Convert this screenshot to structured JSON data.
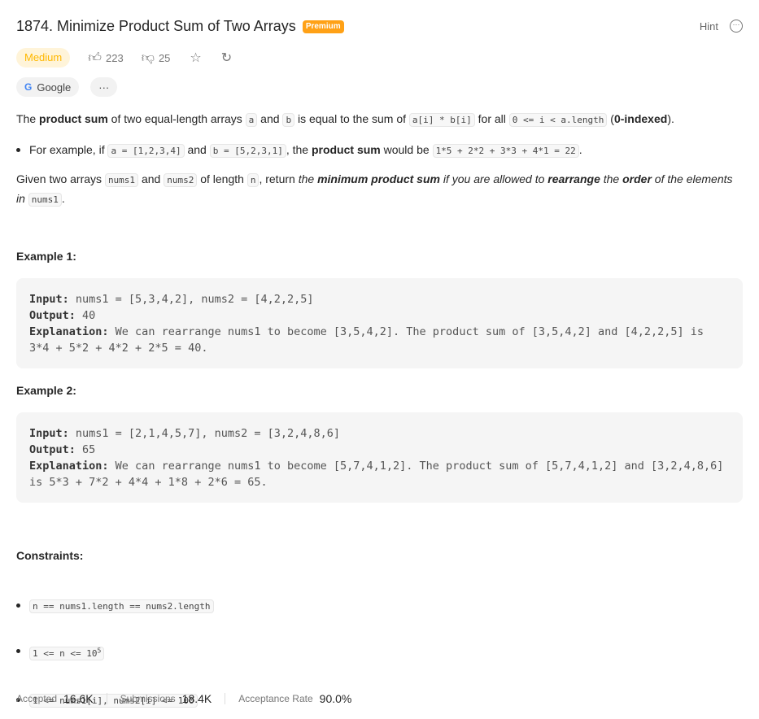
{
  "header": {
    "title": "1874. Minimize Product Sum of Two Arrays",
    "premium_badge": "Premium",
    "hint_label": "Hint",
    "more_icon": "ellipsis-circle-icon"
  },
  "meta": {
    "difficulty": "Medium",
    "likes": "223",
    "dislikes": "25",
    "company": "Google",
    "more": "···"
  },
  "colors": {
    "premium": "#ffa116",
    "medium_text": "#ffb800",
    "medium_bg": "#fff4d9"
  },
  "description": {
    "p1": {
      "t1": "The ",
      "b1": "product sum",
      "t2": " of two equal-length arrays ",
      "c1": "a",
      "t3": " and ",
      "c2": "b",
      "t4": " is equal to the sum of ",
      "c3": "a[i] * b[i]",
      "t5": " for all ",
      "c4": "0 <= i < a.length",
      "t6": " (",
      "b2": "0-indexed",
      "t7": ")."
    },
    "bullet": {
      "t1": "For example, if ",
      "c1": "a = [1,2,3,4]",
      "t2": " and ",
      "c2": "b = [5,2,3,1]",
      "t3": ", the ",
      "b1": "product sum",
      "t4": " would be ",
      "c3": "1*5 + 2*2 + 3*3 + 4*1 = 22",
      "t5": "."
    },
    "p2": {
      "t1": "Given two arrays ",
      "c1": "nums1",
      "t2": " and ",
      "c2": "nums2",
      "t3": " of length ",
      "c3": "n",
      "t4": ", return ",
      "i1": "the ",
      "bi1": "minimum product sum",
      "i2": " if you are allowed to ",
      "bi2": "rearrange",
      "i3": " the ",
      "bi3": "order",
      "i4": " of the elements in",
      "t5": " ",
      "c4": "nums1",
      "t6": "."
    }
  },
  "examples": [
    {
      "heading": "Example 1:",
      "input_label": "Input:",
      "input": " nums1 = [5,3,4,2], nums2 = [4,2,2,5]",
      "output_label": "Output:",
      "output": " 40",
      "explanation_label": "Explanation:",
      "explanation": " We can rearrange nums1 to become [3,5,4,2]. The product sum of [3,5,4,2] and [4,2,2,5] is 3*4 + 5*2 + 4*2 + 2*5 = 40."
    },
    {
      "heading": "Example 2:",
      "input_label": "Input:",
      "input": " nums1 = [2,1,4,5,7], nums2 = [3,2,4,8,6]",
      "output_label": "Output:",
      "output": " 65",
      "explanation_label": "Explanation:",
      "explanation": " We can rearrange nums1 to become [5,7,4,1,2]. The product sum of [5,7,4,1,2] and [3,2,4,8,6] is 5*3 + 7*2 + 4*4 + 1*8 + 2*6 = 65."
    }
  ],
  "constraints": {
    "heading": "Constraints:",
    "items": [
      "n == nums1.length == nums2.length",
      "1 <= n <= 10",
      "1 <= nums1[i], nums2[i] <= 100"
    ],
    "sup": "5"
  },
  "stats": {
    "accepted_label": "Accepted",
    "accepted": "16.6K",
    "submissions_label": "Submissions",
    "submissions": "18.4K",
    "rate_label": "Acceptance Rate",
    "rate": "90.0%"
  }
}
